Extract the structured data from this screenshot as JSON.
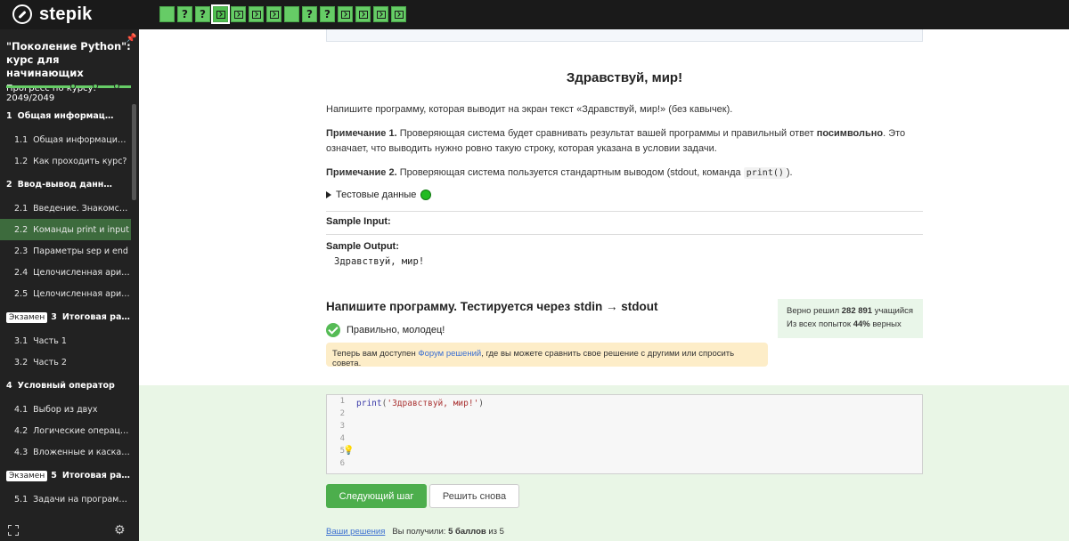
{
  "brand": {
    "name": "stepik"
  },
  "steps": [
    {
      "type": "text",
      "label": ""
    },
    {
      "type": "quiz",
      "label": "?"
    },
    {
      "type": "quiz",
      "label": "?"
    },
    {
      "type": "code",
      "label": "",
      "active": true
    },
    {
      "type": "code",
      "label": ""
    },
    {
      "type": "code",
      "label": ""
    },
    {
      "type": "code",
      "label": ""
    },
    {
      "type": "text",
      "label": ""
    },
    {
      "type": "quiz",
      "label": "?"
    },
    {
      "type": "quiz",
      "label": "?"
    },
    {
      "type": "code",
      "label": ""
    },
    {
      "type": "code",
      "label": ""
    },
    {
      "type": "code",
      "label": ""
    },
    {
      "type": "code",
      "label": ""
    }
  ],
  "sidebar": {
    "course_title": "\"Поколение Python\": курс для начинающих",
    "progress_label": "Прогресс по курсу:",
    "progress_value": "2049/2049",
    "progress_fraction": 1.0,
    "menu": [
      {
        "kind": "section",
        "num": "1",
        "text": "Общая информация о ку…"
      },
      {
        "kind": "item",
        "num": "1.1",
        "text": "Общая информация о …"
      },
      {
        "kind": "item",
        "num": "1.2",
        "text": "Как проходить курс?"
      },
      {
        "kind": "section",
        "num": "2",
        "text": "Ввод-вывод данных"
      },
      {
        "kind": "item",
        "num": "2.1",
        "text": "Введение. Знакомство …"
      },
      {
        "kind": "item",
        "num": "2.2",
        "text": "Команды print и input",
        "active": true
      },
      {
        "kind": "item",
        "num": "2.3",
        "text": "Параметры sep и end"
      },
      {
        "kind": "item",
        "num": "2.4",
        "text": "Целочисленная арифм…"
      },
      {
        "kind": "item",
        "num": "2.5",
        "text": "Целочисленная арифм…"
      },
      {
        "kind": "section",
        "num": "3",
        "text": "Итоговая работа…",
        "badge": "Экзамен"
      },
      {
        "kind": "item",
        "num": "3.1",
        "text": "Часть 1"
      },
      {
        "kind": "item",
        "num": "3.2",
        "text": "Часть 2"
      },
      {
        "kind": "section",
        "num": "4",
        "text": "Условный оператор"
      },
      {
        "kind": "item",
        "num": "4.1",
        "text": "Выбор из двух"
      },
      {
        "kind": "item",
        "num": "4.2",
        "text": "Логические операции"
      },
      {
        "kind": "item",
        "num": "4.3",
        "text": "Вложенные и каскадн…"
      },
      {
        "kind": "section",
        "num": "5",
        "text": "Итоговая работа…",
        "badge": "Экзамен"
      },
      {
        "kind": "item",
        "num": "5.1",
        "text": "Задачи на программир…"
      }
    ]
  },
  "lesson": {
    "title": "Здравствуй, мир!",
    "p1": "Напишите программу, которая выводит на экран текст «Здравствуй, мир!» (без кавычек).",
    "note1_label": "Примечание 1.",
    "note1_a": " Проверяющая система будет сравнивать результат вашей программы и правильный ответ ",
    "note1_bold": "посимвольно",
    "note1_b": ". Это означает, что выводить нужно ровно такую строку, которая указана в условии задачи.",
    "note2_label": "Примечание 2.",
    "note2_a": " Проверяющая система пользуется стандартным выводом (stdout, команда ",
    "note2_code": "print()",
    "note2_b": ").",
    "tests_label": "Тестовые данные",
    "sample_input_label": "Sample Input:",
    "sample_output_label": "Sample Output:",
    "sample_output": "Здравствуй, мир!"
  },
  "task": {
    "heading": "Напишите программу. Тестируется через stdin → stdout",
    "stats_line1_a": "Верно решил ",
    "stats_line1_num": "282 891",
    "stats_line1_b": " учащийся",
    "stats_line2_a": "Из всех попыток ",
    "stats_line2_num": "44%",
    "stats_line2_b": " верных",
    "ok_text": "Правильно, молодец!",
    "notice_a": "Теперь вам доступен ",
    "notice_link": "Форум решений",
    "notice_b": ", где вы можете сравнить свое решение с другими или спросить совета."
  },
  "editor": {
    "line_numbers": [
      "1",
      "2",
      "3",
      "4",
      "5",
      "6"
    ],
    "code_fn": "print",
    "code_open": "(",
    "code_str": "'Здравствуй, мир!'",
    "code_close": ")"
  },
  "actions": {
    "next_label": "Следующий шаг",
    "retry_label": "Решить снова",
    "solutions_link": "Ваши решения",
    "score_a": "Вы получили: ",
    "score_bold": "5 баллов",
    "score_b": " из 5"
  },
  "colors": {
    "accent_green": "#66cc66",
    "sidebar_bg": "#222222",
    "topbar_bg": "#1a1a1a",
    "link_blue": "#3b6fd1"
  }
}
